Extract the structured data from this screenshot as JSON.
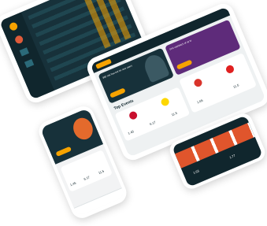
{
  "brand_color": "#f7a300",
  "dark_bg": "#17313a",
  "card_bg": "#ffffff",
  "tablet_main": {
    "banner_left": {
      "headline": "$50 risk free bet for new users",
      "button_icon": "orange-cta"
    },
    "banner_right": {
      "headline": "10% cashback of up to",
      "button_icon": "orange-cta"
    },
    "section_title": "Top Events",
    "event_odds": [
      "1.45",
      "6.17",
      "11.5"
    ],
    "side_odds": [
      "1.65",
      "11.5"
    ]
  },
  "tablet_back": {
    "icons": [
      "bell-icon",
      "football-icon",
      "chart-icon",
      "ticket-icon"
    ]
  },
  "phone_left": {
    "promo": "orange-cta",
    "odds": [
      "1.45",
      "6.17",
      "11.5"
    ]
  },
  "phone_right": {
    "odds": [
      "1.63",
      "1.77"
    ]
  }
}
